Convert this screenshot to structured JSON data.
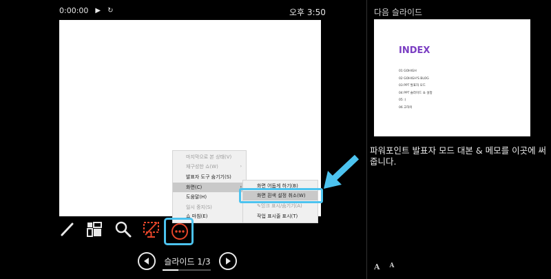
{
  "timer": {
    "time": "0:00:00",
    "pause_icon": "play-icon",
    "reset_icon": "reset-icon"
  },
  "clock": "오후 3:50",
  "next_slide": {
    "label": "다음 슬라이드",
    "title": "INDEX",
    "items": [
      "01 GOHIGH",
      "02 GOHIGH'S BLOG",
      "03 PPT 발표자 모드",
      "04 PPT 슬라이드 쇼 설정",
      "05 :)",
      "06 고하이"
    ],
    "title_color": "#7a3dc2"
  },
  "notes": "파워포인트 발표자 모드 대본 & 메모를 이곳에 써줍니다.",
  "font_buttons": {
    "increase": "A",
    "decrease": "A"
  },
  "context_menu": {
    "items": [
      {
        "label": "마지막으로 본 상태(V)",
        "disabled": true
      },
      {
        "label": "재구성한 쇼(W)",
        "disabled": true,
        "submenu": true
      },
      {
        "label": "발표자 도구 숨기기(S)",
        "disabled": false
      },
      {
        "label": "화면(C)",
        "disabled": false,
        "submenu": true,
        "highlighted": true
      },
      {
        "label": "도움말(H)",
        "disabled": false
      },
      {
        "label": "일시 중지(S)",
        "disabled": true
      },
      {
        "label": "쇼 마침(E)",
        "disabled": false
      }
    ]
  },
  "screen_submenu": {
    "items": [
      {
        "label": "화면 어둡게 하기(B)",
        "disabled": false
      },
      {
        "label": "화면 흰색 설정 취소(W)",
        "disabled": false,
        "highlighted": true
      },
      {
        "label": "잉크 표시/숨기기(A)",
        "disabled": true
      },
      {
        "label": "작업 표시줄 표시(T)",
        "disabled": false
      }
    ]
  },
  "toolbar_icons": [
    "pen-icon",
    "slides-grid-icon",
    "zoom-icon",
    "black-screen-icon",
    "more-options-icon"
  ],
  "slide_nav": {
    "counter": "슬라이드 1/3",
    "progress": 0.33
  },
  "colors": {
    "highlight": "#4cc3ef",
    "accent": "#e8462a"
  }
}
